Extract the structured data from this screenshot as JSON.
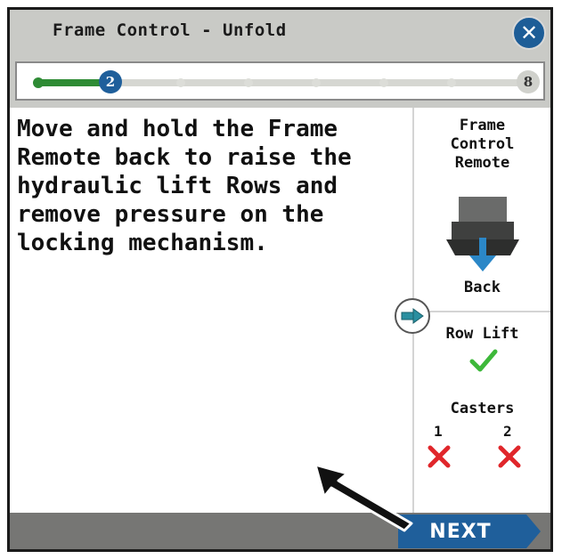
{
  "window": {
    "title": "Frame Control - Unfold",
    "close_icon": "close-icon"
  },
  "progress": {
    "current_step": "2",
    "total_steps": "8",
    "fraction_complete": 0.143
  },
  "instruction": {
    "text": "Move and hold the Frame Remote back to raise the hydraulic lift Rows and remove pressure on the locking mechanism."
  },
  "side_panel": {
    "title_line1": "Frame",
    "title_line2": "Control",
    "title_line3": "Remote",
    "remote_icon": "frame-remote-back-icon",
    "direction_label": "Back",
    "row_lift_label": "Row Lift",
    "row_lift_status": "check-icon",
    "casters_label": "Casters",
    "caster1_label": "1",
    "caster2_label": "2",
    "caster1_status": "x-icon",
    "caster2_status": "x-icon"
  },
  "footer": {
    "next_label": "NEXT"
  },
  "colors": {
    "accent_blue": "#1f5f9b",
    "progress_green": "#2e8b34",
    "check_green": "#3db83a",
    "error_red": "#e0262b",
    "arrow_teal": "#2a8fa0",
    "bar_gray": "#c9cac6"
  }
}
